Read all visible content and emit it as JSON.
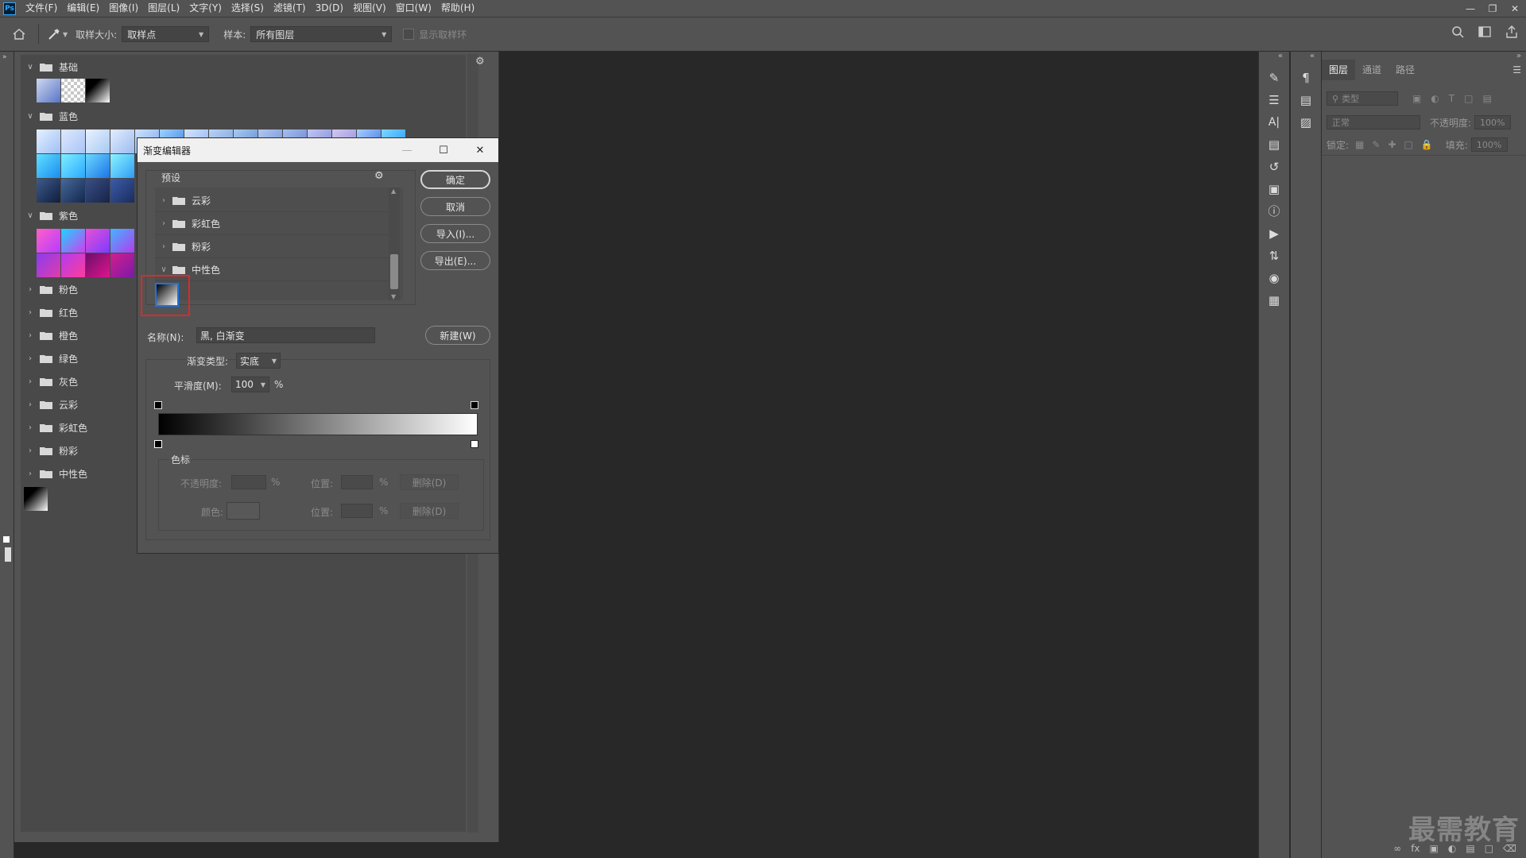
{
  "menubar": {
    "logo": "Ps",
    "items": [
      "文件(F)",
      "编辑(E)",
      "图像(I)",
      "图层(L)",
      "文字(Y)",
      "选择(S)",
      "滤镜(T)",
      "3D(D)",
      "视图(V)",
      "窗口(W)",
      "帮助(H)"
    ]
  },
  "optionsbar": {
    "sample_size_label": "取样大小:",
    "sample_size_value": "取样点",
    "sample_label": "样本:",
    "sample_value": "所有图层",
    "show_ring_label": "显示取样环"
  },
  "gradients_panel": {
    "groups_open": [
      {
        "name": "基础"
      },
      {
        "name": "蓝色"
      },
      {
        "name": "紫色"
      }
    ],
    "groups_closed": [
      "粉色",
      "红色",
      "橙色",
      "绿色",
      "灰色",
      "云彩",
      "彩虹色",
      "粉彩",
      "中性色"
    ]
  },
  "dialog": {
    "title": "渐变编辑器",
    "presets_label": "预设",
    "preset_folders": [
      "云彩",
      "彩虹色",
      "粉彩",
      "中性色"
    ],
    "buttons": {
      "ok": "确定",
      "cancel": "取消",
      "import": "导入(I)...",
      "export": "导出(E)...",
      "new": "新建(W)"
    },
    "name_label": "名称(N):",
    "name_value": "黑, 白渐变",
    "gradient_type_label": "渐变类型:",
    "gradient_type_value": "实底",
    "smoothness_label": "平滑度(M):",
    "smoothness_value": "100",
    "percent": "%",
    "stops_label": "色标",
    "opacity_label": "不透明度:",
    "location_label": "位置:",
    "color_label": "颜色:",
    "delete_label": "删除(D)"
  },
  "layers_panel": {
    "tabs": [
      "图层",
      "通道",
      "路径"
    ],
    "kind_placeholder": "类型",
    "blend_mode": "正常",
    "opacity_label": "不透明度:",
    "opacity_value": "100%",
    "lock_label": "锁定:",
    "fill_label": "填充:",
    "fill_value": "100%"
  },
  "watermark": "最需教育",
  "colors": {
    "accent_blue": "#1a73e8",
    "highlight_red": "#e0272b",
    "panel_bg": "#535353",
    "canvas_bg": "#282828"
  }
}
